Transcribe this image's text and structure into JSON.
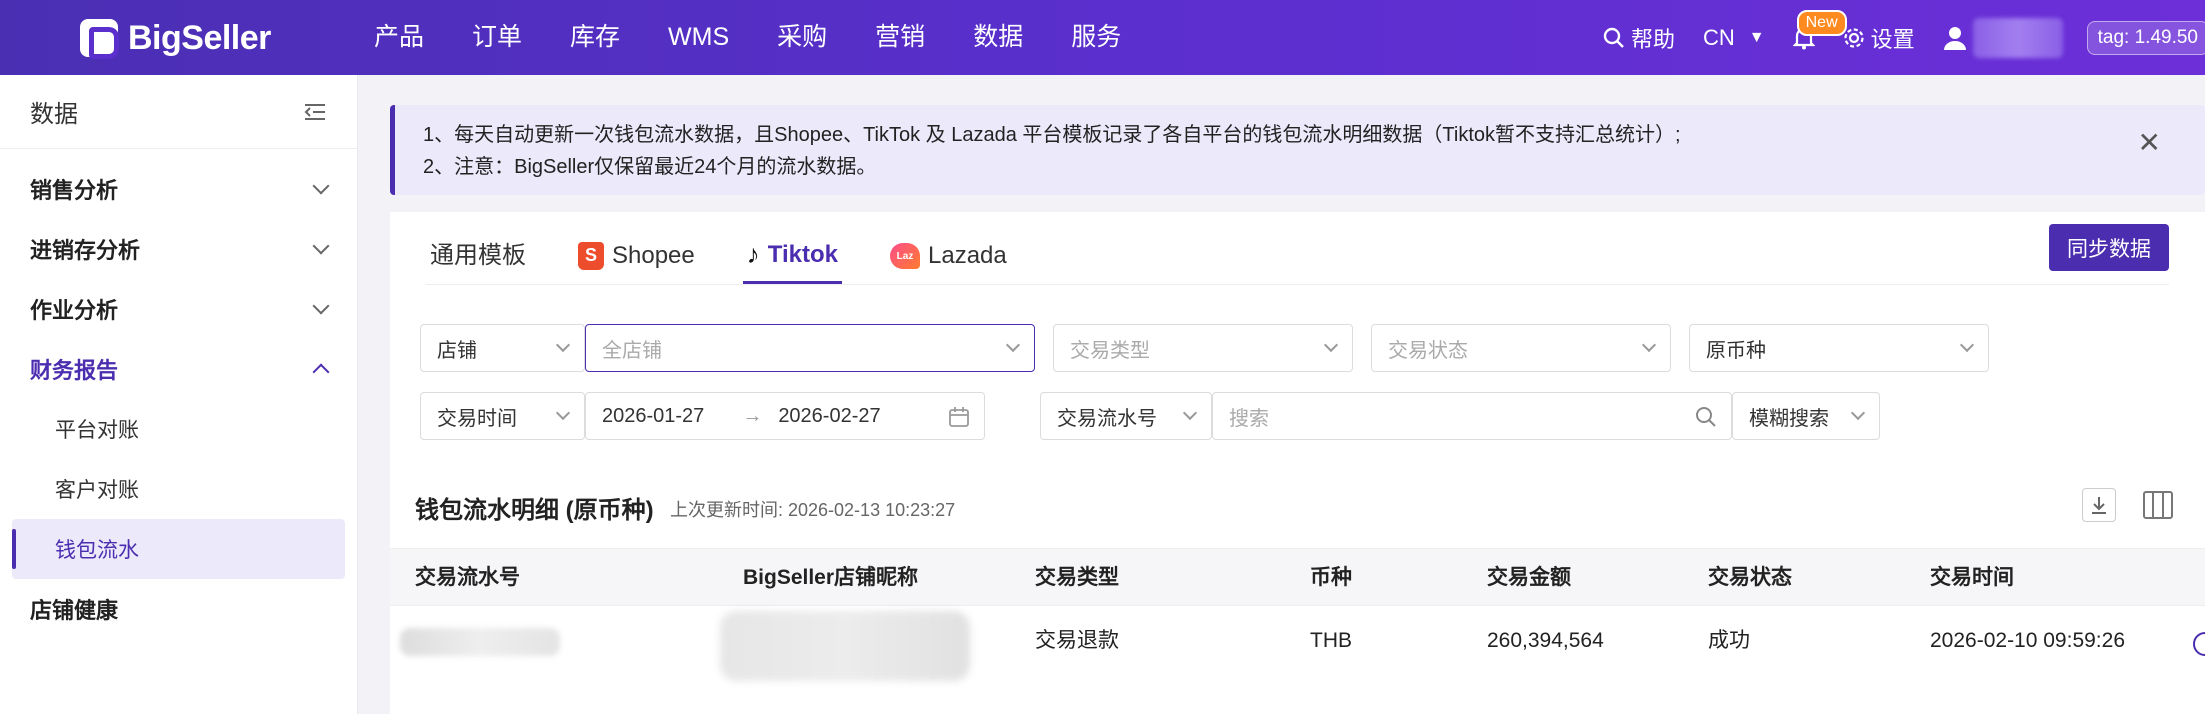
{
  "brand": {
    "name": "BigSeller"
  },
  "topnav": {
    "items": [
      "产品",
      "订单",
      "库存",
      "WMS",
      "采购",
      "营销",
      "数据",
      "服务"
    ],
    "help": "帮助",
    "lang": "CN",
    "new_badge": "New",
    "settings": "设置",
    "tag": "tag: 1.49.50"
  },
  "sidebar": {
    "title": "数据",
    "groups": [
      {
        "label": "销售分析"
      },
      {
        "label": "进销存分析"
      },
      {
        "label": "作业分析"
      },
      {
        "label": "财务报告"
      }
    ],
    "subitems": [
      "平台对账",
      "客户对账",
      "钱包流水"
    ],
    "last_group": "店铺健康"
  },
  "notice": {
    "line1": "1、每天自动更新一次钱包流水数据，且Shopee、TikTok 及 Lazada 平台模板记录了各自平台的钱包流水明细数据（Tiktok暂不支持汇总统计）;",
    "line2": "2、注意：BigSeller仅保留最近24个月的流水数据。"
  },
  "tabs": [
    "通用模板",
    "Shopee",
    "Tiktok",
    "Lazada"
  ],
  "sync_button": "同步数据",
  "filters": {
    "store_label": "店铺",
    "store_placeholder": "全店铺",
    "trade_type": "交易类型",
    "trade_status": "交易状态",
    "currency": "原币种",
    "time_label": "交易时间",
    "date_from": "2026-01-27",
    "date_to": "2026-02-27",
    "serial_label": "交易流水号",
    "search_placeholder": "搜索",
    "fuzzy": "模糊搜索"
  },
  "section": {
    "title": "钱包流水明细 (原币种)",
    "updated": "上次更新时间: 2026-02-13 10:23:27"
  },
  "table": {
    "headers": [
      "交易流水号",
      "BigSeller店铺昵称",
      "交易类型",
      "币种",
      "交易金额",
      "交易状态",
      "交易时间"
    ],
    "row": {
      "type": "交易退款",
      "currency": "THB",
      "amount": "260,394,564",
      "status": "成功",
      "time": "2026-02-10 09:59:26"
    }
  }
}
